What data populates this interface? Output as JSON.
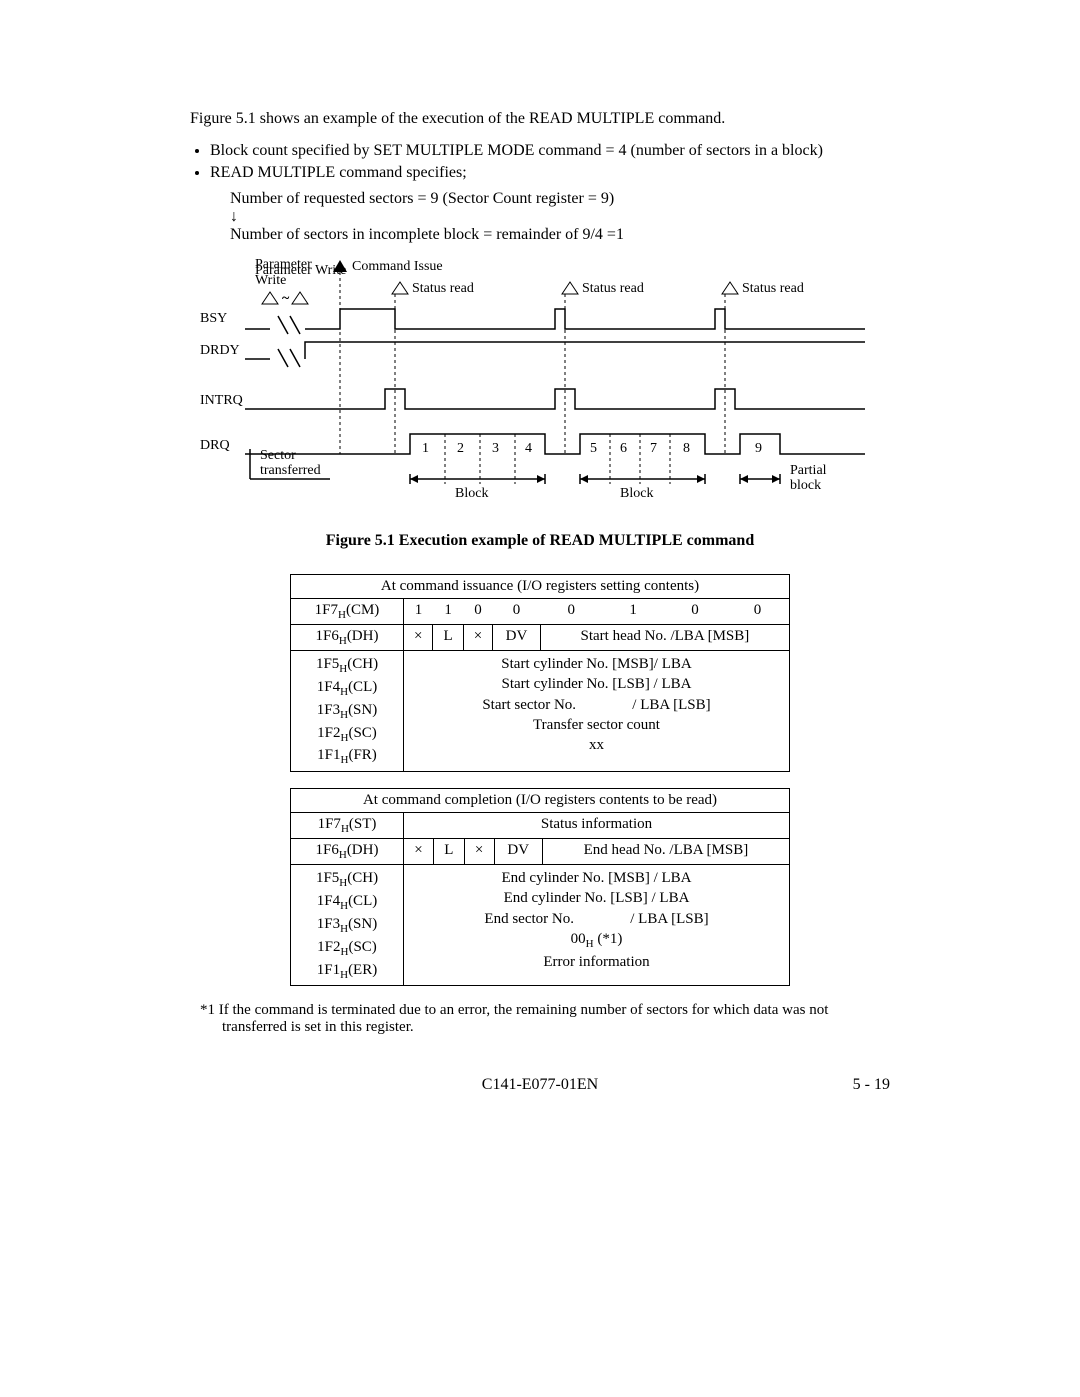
{
  "intro": "Figure 5.1 shows an example of the execution of the READ MULTIPLE command.",
  "bullets": {
    "b1": "Block count specified by SET MULTIPLE MODE command = 4 (number of sectors in a block)",
    "b2a": "READ MULTIPLE command specifies;",
    "b2b": "Number of requested sectors = 9 (Sector Count register = 9)",
    "b2c": "↓",
    "b2d": "Number of sectors in incomplete block = remainder of 9/4 =1"
  },
  "diagram": {
    "paramWrite": "Parameter Write",
    "cmdIssue": "Command Issue",
    "statusRead": "Status read",
    "bsy": "BSY",
    "drdy": "DRDY",
    "intrq": "INTRQ",
    "drq": "DRQ",
    "sectorTransferred": "Sector transferred",
    "block": "Block",
    "partialBlock": "Partial block",
    "nums": {
      "n1": "1",
      "n2": "2",
      "n3": "3",
      "n4": "4",
      "n5": "5",
      "n6": "6",
      "n7": "7",
      "n8": "8",
      "n9": "9"
    }
  },
  "figcaption": "Figure 5.1    Execution example of READ MULTIPLE command",
  "table1": {
    "title": "At command issuance (I/O registers setting contents)",
    "r1reg": "1F7",
    "r1suf": "(CM)",
    "r1bits": {
      "b7": "1",
      "b6": "1",
      "b5": "0",
      "b4": "0",
      "b3": "0",
      "b2": "1",
      "b1": "0",
      "b0": "0"
    },
    "r2reg": "1F6",
    "r2suf": "(DH)",
    "r2c1": "×",
    "r2c2": "L",
    "r2c3": "×",
    "r2c4": "DV",
    "r2c5": "Start head No. /LBA [MSB]",
    "block": {
      "l1reg": "1F5",
      "l1suf": "(CH)",
      "l1txt": "Start cylinder No. [MSB]/ LBA",
      "l2reg": "1F4",
      "l2suf": "(CL)",
      "l2txt": "Start cylinder No. [LSB] / LBA",
      "l3reg": "1F3",
      "l3suf": "(SN)",
      "l3txt": "Start sector No.               / LBA [LSB]",
      "l4reg": "1F2",
      "l4suf": "(SC)",
      "l4txt": "Transfer sector count",
      "l5reg": "1F1",
      "l5suf": "(FR)",
      "l5txt": "xx"
    }
  },
  "table2": {
    "title": "At command completion (I/O registers contents to be read)",
    "r1reg": "1F7",
    "r1suf": "(ST)",
    "r1txt": "Status information",
    "r2reg": "1F6",
    "r2suf": "(DH)",
    "r2c1": "×",
    "r2c2": "L",
    "r2c3": "×",
    "r2c4": "DV",
    "r2c5": "End head No. /LBA [MSB]",
    "block": {
      "l1reg": "1F5",
      "l1suf": "(CH)",
      "l1txt": "End cylinder No. [MSB] / LBA",
      "l2reg": "1F4",
      "l2suf": "(CL)",
      "l2txt": "End cylinder No. [LSB]  / LBA",
      "l3reg": "1F3",
      "l3suf": "(SN)",
      "l3txt": "End sector No.               / LBA [LSB]",
      "l4reg": "1F2",
      "l4suf": "(SC)",
      "l4txtPre": "00",
      "l4txtPost": " (*1)",
      "l5reg": "1F1",
      "l5suf": "(ER)",
      "l5txt": "Error information"
    }
  },
  "footnote": "*1 If the command is terminated due to an error, the remaining number of sectors for which data was not transferred is set in this register.",
  "footer_center": "C141-E077-01EN",
  "footer_page": "5 - 19",
  "H": "H"
}
